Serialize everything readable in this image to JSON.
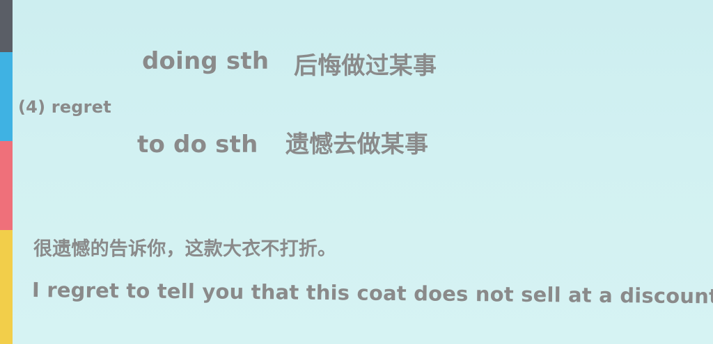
{
  "colors": {
    "background": "#d2f1f2",
    "text": "#8a8a8a",
    "strip": [
      "#5a5e66",
      "#3fb2e3",
      "#ef707a",
      "#f2ce4a"
    ]
  },
  "slide": {
    "item_label": "(4) regret",
    "forms": [
      {
        "pattern": "doing sth",
        "meaning": "后悔做过某事"
      },
      {
        "pattern": "to do sth",
        "meaning": "遗憾去做某事"
      }
    ],
    "example": {
      "chinese": "很遗憾的告诉你，这款大衣不打折。",
      "english": "I regret to tell you that this coat does not sell at a discount."
    }
  }
}
